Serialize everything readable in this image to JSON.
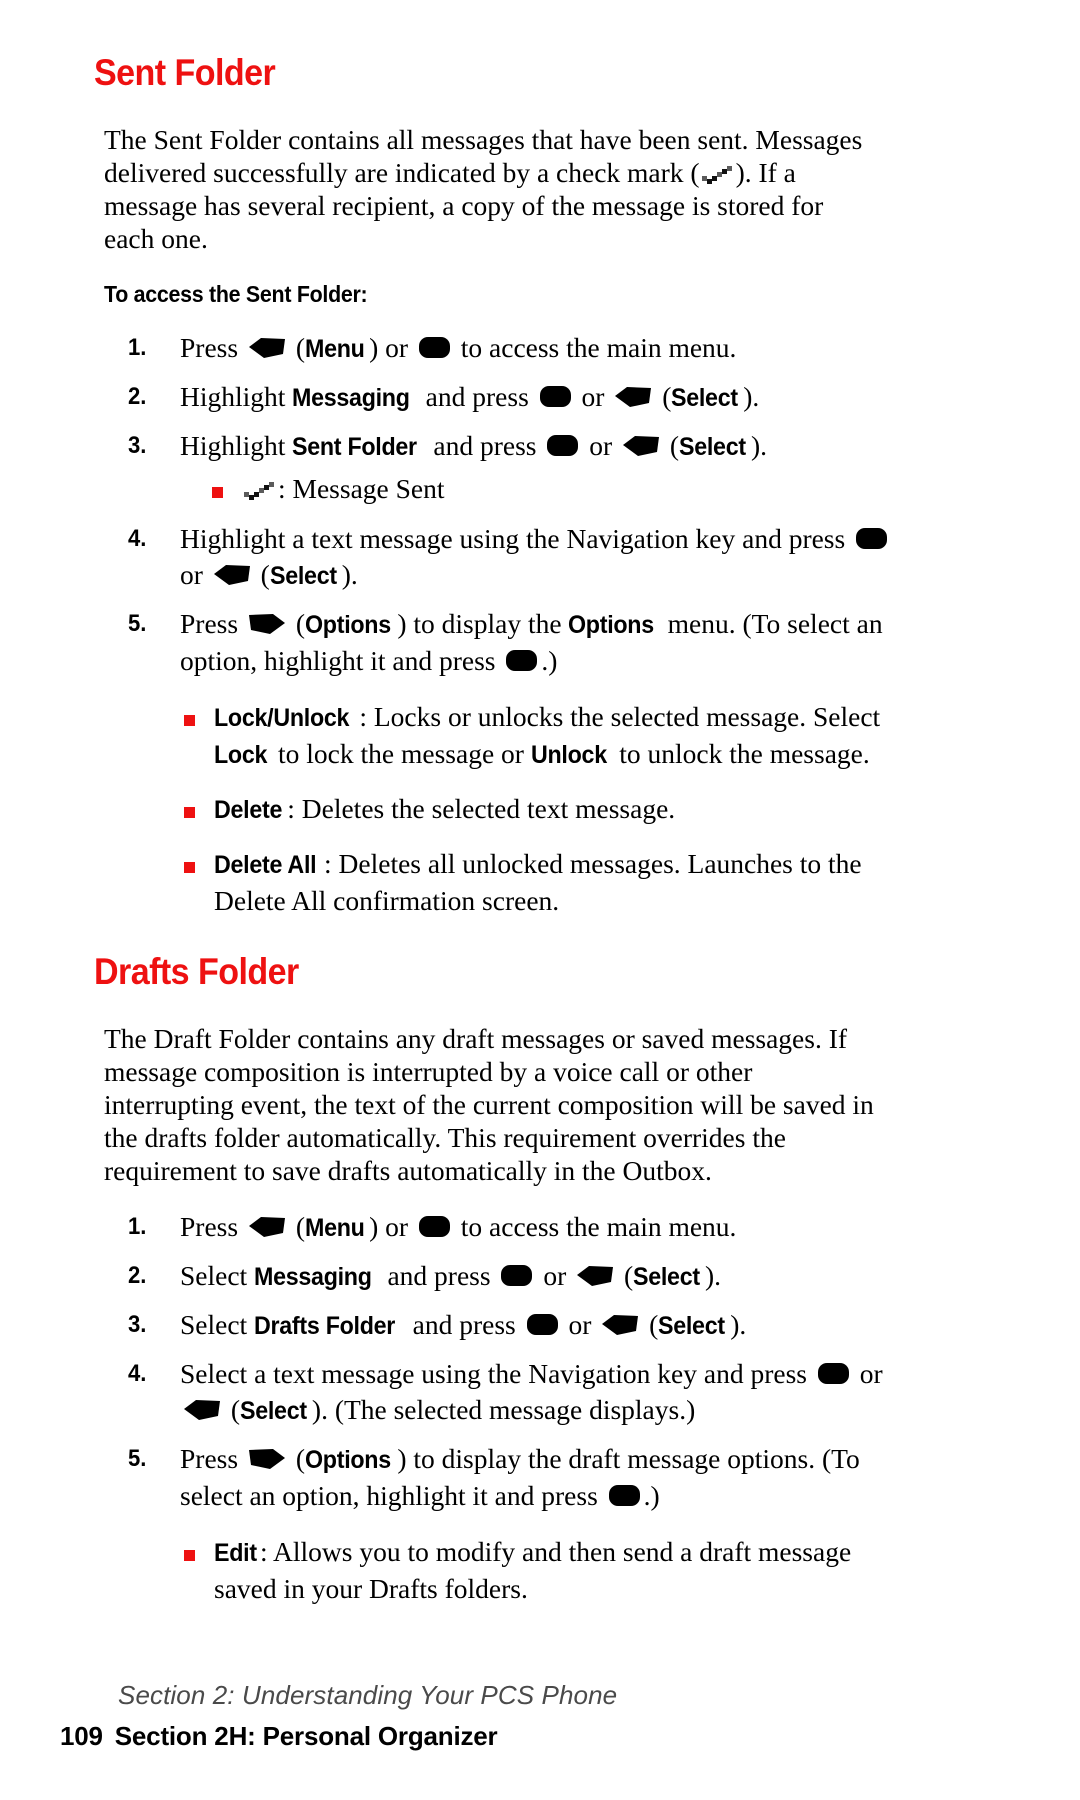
{
  "page": {
    "number": "109",
    "colors": {
      "heading_red": "#ee1111",
      "bullet_red": "#ee1111",
      "body_black": "#000000",
      "footer_gray": "#4a4a4a"
    }
  },
  "sections": [
    {
      "id": "sent-folder",
      "heading": "Sent Folder",
      "intro": {
        "part1": "The Sent Folder contains all messages that have been sent. Messages delivered successfully are indicated by a check mark (",
        "icon": "check-mark-icon",
        "part2": "). If a message has several recipient, a copy of the message is stored for each one."
      },
      "subheading": "To access the Sent Folder:",
      "steps": [
        {
          "num": "1.",
          "t1": "Press ",
          "icon1": "soft-key-left-icon",
          "t2": " (",
          "b1": "Menu",
          "t3": ") or ",
          "icon2": "ok-key-icon",
          "t4": " to access the main menu."
        },
        {
          "num": "2.",
          "t1": "Highlight ",
          "b1": "Messaging",
          "t2": " and press ",
          "icon1": "ok-key-icon",
          "t3": " or ",
          "icon2": "soft-key-left-icon",
          "t4": " (",
          "b2": "Select",
          "t5": ")."
        },
        {
          "num": "3.",
          "t1": "Highlight ",
          "b1": "Sent Folder",
          "t2": " and press ",
          "icon1": "ok-key-icon",
          "t3": " or ",
          "icon2": "soft-key-left-icon",
          "t4": " (",
          "b2": "Select",
          "t5": ")."
        },
        {
          "num": "4.",
          "t1": "Highlight a text message using the Navigation key and press ",
          "icon1": "ok-key-icon",
          "t2": " or ",
          "icon2": "soft-key-left-icon",
          "t3": " (",
          "b1": "Select",
          "t4": ")."
        },
        {
          "num": "5.",
          "t1": "Press ",
          "icon1": "soft-key-right-icon",
          "t2": " (",
          "b1": "Options",
          "t3": ") to display the ",
          "b2": "Options",
          "t4": " menu. (To select an option, highlight it and press ",
          "icon2": "ok-key-icon",
          "t5": ".)"
        }
      ],
      "step3_note": {
        "icon": "check-mark-icon",
        "text": ": Message Sent"
      },
      "options_bullets": [
        {
          "b1": "Lock/Unlock",
          "t1": ": Locks or unlocks the selected message. Select ",
          "b2": "Lock",
          "t2": " to lock the message or ",
          "b3": "Unlock",
          "t3": " to unlock the message."
        },
        {
          "b1": "Delete",
          "t1": ": Deletes the selected text message."
        },
        {
          "b1": "Delete All",
          "t1": ": Deletes all unlocked messages. Launches to the Delete All confirmation screen."
        }
      ]
    },
    {
      "id": "drafts-folder",
      "heading": "Drafts Folder",
      "intro": "The Draft Folder contains any draft messages or saved messages. If message composition is interrupted by a voice call or other interrupting event, the text of the current composition will be saved in the drafts folder automatically. This requirement overrides the requirement to save drafts automatically in the Outbox.",
      "steps": [
        {
          "num": "1.",
          "t1": "Press ",
          "icon1": "soft-key-left-icon",
          "t2": " (",
          "b1": "Menu",
          "t3": ") or ",
          "icon2": "ok-key-icon",
          "t4": " to access the main menu."
        },
        {
          "num": "2.",
          "t1": "Select ",
          "b1": "Messaging",
          "t2": " and press ",
          "icon1": "ok-key-icon",
          "t3": " or ",
          "icon2": "soft-key-left-icon",
          "t4": " (",
          "b2": "Select",
          "t5": ")."
        },
        {
          "num": "3.",
          "t1": "Select ",
          "b1": "Drafts Folder",
          "t2": " and press ",
          "icon1": "ok-key-icon",
          "t3": " or ",
          "icon2": "soft-key-left-icon",
          "t4": " (",
          "b2": "Select",
          "t5": ")."
        },
        {
          "num": "4.",
          "t1": "Select a text message using the Navigation key and press ",
          "icon1": "ok-key-icon",
          "t2": " or ",
          "icon2": "soft-key-left-icon",
          "t3": " (",
          "b1": "Select",
          "t4": "). (The selected message displays.)"
        },
        {
          "num": "5.",
          "t1": "Press ",
          "icon1": "soft-key-right-icon",
          "t2": " (",
          "b1": "Options",
          "t3": ") to display the draft message options. (To select an option, highlight it and press ",
          "icon2": "ok-key-icon",
          "t4": ".)"
        }
      ],
      "options_bullets": [
        {
          "b1": "Edit",
          "t1": ": Allows you to modify and then send a draft message saved in your Drafts folders."
        }
      ]
    }
  ],
  "footer": {
    "line1": "Section 2: Understanding Your PCS Phone",
    "page_number": "109",
    "line2": "Section 2H: Personal Organizer"
  }
}
